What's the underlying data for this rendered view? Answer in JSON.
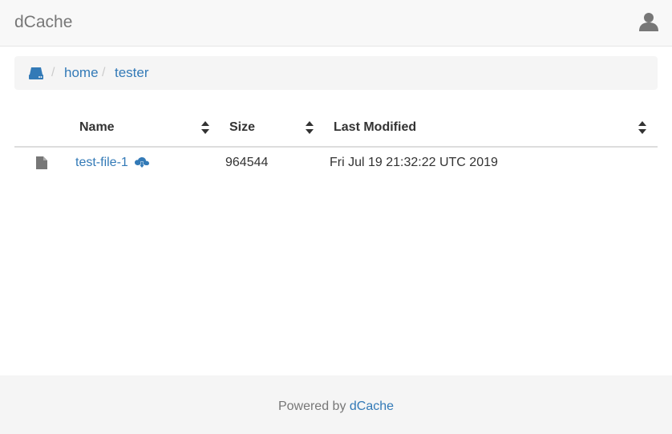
{
  "navbar": {
    "brand": "dCache",
    "user_icon": "user-icon"
  },
  "breadcrumb": {
    "root_icon": "drive-icon",
    "items": [
      "home",
      "tester"
    ],
    "separator": "/"
  },
  "table": {
    "columns": [
      "Name",
      "Size",
      "Last Modified"
    ],
    "sort_icon": "sort-icon",
    "rows": [
      {
        "icon": "file-icon",
        "name": "test-file-1",
        "action_icon": "cloud-download-icon",
        "size": "964544",
        "modified": "Fri Jul 19 21:32:22 UTC 2019"
      }
    ]
  },
  "footer": {
    "prefix": "Powered by ",
    "link": "dCache"
  },
  "colors": {
    "link": "#337ab7",
    "navbar_bg": "#f8f8f8",
    "breadcrumb_bg": "#f5f5f5",
    "icon_gray": "#777777"
  }
}
